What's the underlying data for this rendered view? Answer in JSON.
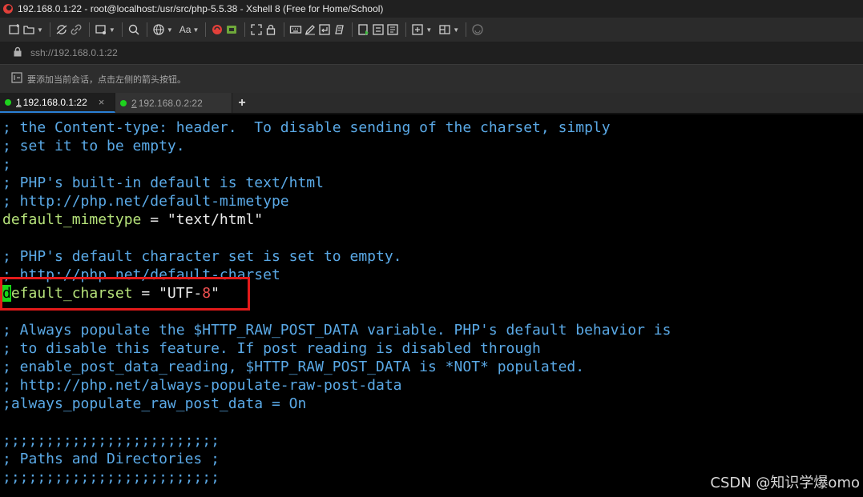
{
  "window": {
    "title": "192.168.0.1:22 - root@localhost:/usr/src/php-5.5.38 - Xshell 8 (Free for Home/School)"
  },
  "address": {
    "url": "ssh://192.168.0.1:22"
  },
  "hint": {
    "text": "要添加当前会话，点击左侧的箭头按钮。"
  },
  "toolbar": {
    "font_label": "Aa"
  },
  "tabs": [
    {
      "num": "1",
      "label": "192.168.0.1:22",
      "active": true,
      "close": "×"
    },
    {
      "num": "2",
      "label": "192.168.0.2:22",
      "active": false
    }
  ],
  "tab_add": "+",
  "terminal": {
    "lines": [
      "; the Content-type: header.  To disable sending of the charset, simply",
      "; set it to be empty.",
      ";",
      "; PHP's built-in default is text/html",
      "; http://php.net/default-mimetype",
      "_default_mimetype_",
      "",
      "; PHP's default character set is set to empty.",
      "; http://php.net/default-charset",
      "_default_charset_",
      "",
      "; Always populate the $HTTP_RAW_POST_DATA variable. PHP's default behavior is",
      "; to disable this feature. If post reading is disabled through",
      "; enable_post_data_reading, $HTTP_RAW_POST_DATA is *NOT* populated.",
      "; http://php.net/always-populate-raw-post-data",
      ";always_populate_raw_post_data = On",
      "",
      ";;;;;;;;;;;;;;;;;;;;;;;;;",
      "; Paths and Directories ;",
      ";;;;;;;;;;;;;;;;;;;;;;;;;"
    ],
    "mimetype": {
      "key": "default_mimetype",
      "op": " = ",
      "value": "\"text/html\""
    },
    "charset": {
      "cursor_char": "d",
      "key_rest": "efault_charset",
      "op": " = ",
      "value_a": "\"UTF-",
      "value_b": "8",
      "value_c": "\""
    }
  },
  "watermark": "CSDN @知识学爆omo",
  "colors": {
    "comment": "#5aa9e6",
    "key": "#b6e27a",
    "cursor": "#17d617",
    "highlight": "#e31a1a"
  }
}
